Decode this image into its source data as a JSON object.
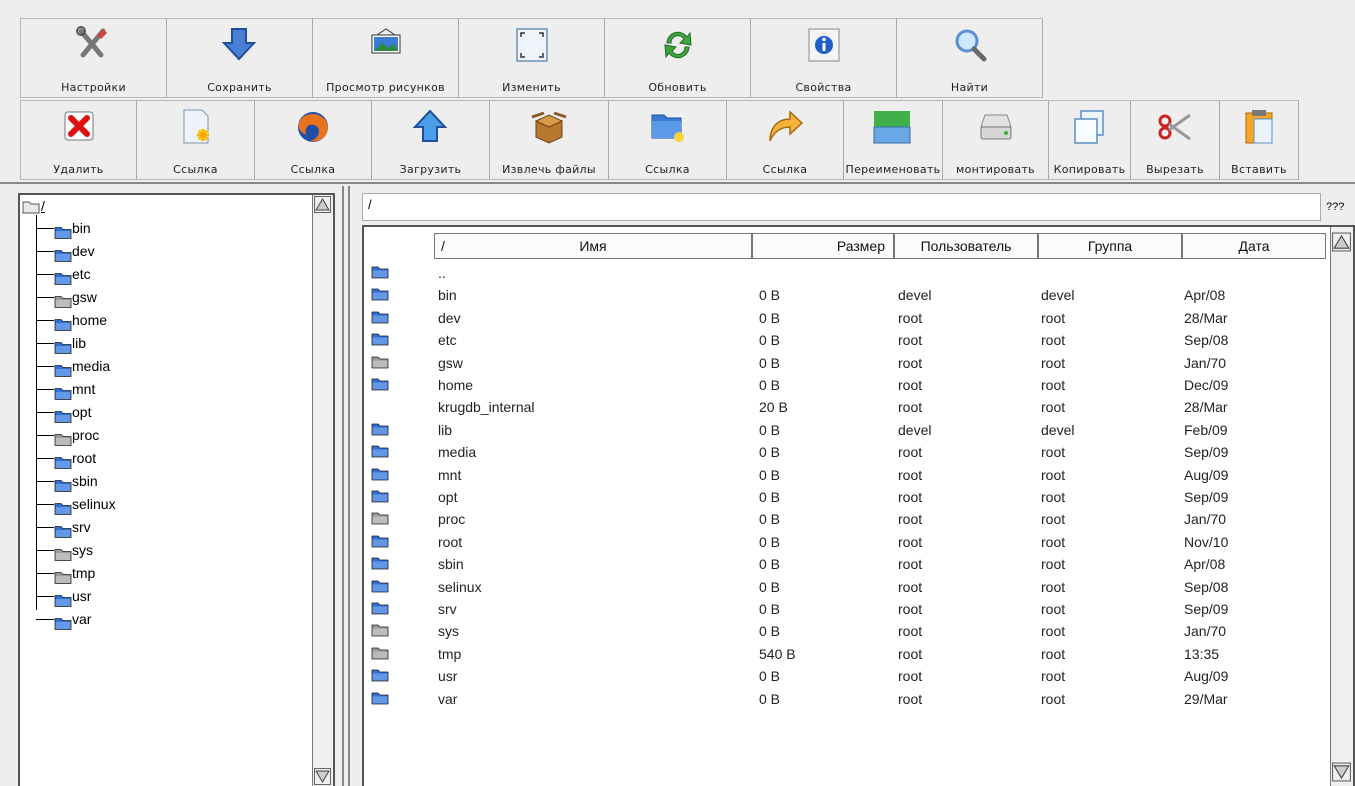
{
  "toolbar_top": [
    {
      "label": "Настройки",
      "icon": "tools-icon",
      "width": 146
    },
    {
      "label": "Сохранить",
      "icon": "save-arrow-icon",
      "width": 146
    },
    {
      "label": "Просмотр рисунков",
      "icon": "image-view-icon",
      "width": 146
    },
    {
      "label": "Изменить",
      "icon": "resize-icon",
      "width": 146
    },
    {
      "label": "Обновить",
      "icon": "refresh-icon",
      "width": 146
    },
    {
      "label": "Свойства",
      "icon": "info-icon",
      "width": 146
    },
    {
      "label": "Найти",
      "icon": "search-icon",
      "width": 146
    }
  ],
  "toolbar_bottom": [
    {
      "label": "Удалить",
      "icon": "delete-icon",
      "width": 116
    },
    {
      "label": "Ссылка",
      "icon": "new-file-icon",
      "width": 118
    },
    {
      "label": "Ссылка",
      "icon": "firefox-icon",
      "width": 117
    },
    {
      "label": "Загрузить",
      "icon": "upload-arrow-icon",
      "width": 118
    },
    {
      "label": "Извлечь файлы",
      "icon": "extract-box-icon",
      "width": 119
    },
    {
      "label": "Ссылка",
      "icon": "new-folder-icon",
      "width": 118
    },
    {
      "label": "Ссылка",
      "icon": "forward-arrow-icon",
      "width": 117
    },
    {
      "label": "Переименовать",
      "icon": "rename-windows-icon",
      "width": 99
    },
    {
      "label": "монтировать",
      "icon": "mount-drive-icon",
      "width": 106
    },
    {
      "label": "Копировать",
      "icon": "copy-icon",
      "width": 82
    },
    {
      "label": "Вырезать",
      "icon": "scissors-icon",
      "width": 89
    },
    {
      "label": "Вставить",
      "icon": "paste-icon",
      "width": 79
    }
  ],
  "tree": {
    "root": "/",
    "items": [
      {
        "name": "bin",
        "color": "blue"
      },
      {
        "name": "dev",
        "color": "blue"
      },
      {
        "name": "etc",
        "color": "blue"
      },
      {
        "name": "gsw",
        "color": "gray"
      },
      {
        "name": "home",
        "color": "blue"
      },
      {
        "name": "lib",
        "color": "blue"
      },
      {
        "name": "media",
        "color": "blue"
      },
      {
        "name": "mnt",
        "color": "blue"
      },
      {
        "name": "opt",
        "color": "blue"
      },
      {
        "name": "proc",
        "color": "gray"
      },
      {
        "name": "root",
        "color": "blue"
      },
      {
        "name": "sbin",
        "color": "blue"
      },
      {
        "name": "selinux",
        "color": "blue"
      },
      {
        "name": "srv",
        "color": "blue"
      },
      {
        "name": "sys",
        "color": "gray"
      },
      {
        "name": "tmp",
        "color": "gray"
      },
      {
        "name": "usr",
        "color": "blue"
      },
      {
        "name": "var",
        "color": "blue"
      }
    ]
  },
  "path": {
    "value": "/",
    "button": "???"
  },
  "list": {
    "columns": {
      "sort": "/",
      "name": "Имя",
      "size": "Размер",
      "user": "Пользователь",
      "group": "Группа",
      "date": "Дата"
    },
    "rows": [
      {
        "name": "..",
        "size": "",
        "user": "",
        "group": "",
        "date": "",
        "icon": "blue"
      },
      {
        "name": "bin",
        "size": "0 B",
        "user": "devel",
        "group": "devel",
        "date": "Apr/08",
        "icon": "blue"
      },
      {
        "name": "dev",
        "size": "0 B",
        "user": "root",
        "group": "root",
        "date": "28/Mar",
        "icon": "blue"
      },
      {
        "name": "etc",
        "size": "0 B",
        "user": "root",
        "group": "root",
        "date": "Sep/08",
        "icon": "blue"
      },
      {
        "name": "gsw",
        "size": "0 B",
        "user": "root",
        "group": "root",
        "date": "Jan/70",
        "icon": "gray"
      },
      {
        "name": "home",
        "size": "0 B",
        "user": "root",
        "group": "root",
        "date": "Dec/09",
        "icon": "blue"
      },
      {
        "name": "krugdb_internal",
        "size": "20 B",
        "user": "root",
        "group": "root",
        "date": "28/Mar",
        "icon": "none"
      },
      {
        "name": "lib",
        "size": "0 B",
        "user": "devel",
        "group": "devel",
        "date": "Feb/09",
        "icon": "blue"
      },
      {
        "name": "media",
        "size": "0 B",
        "user": "root",
        "group": "root",
        "date": "Sep/09",
        "icon": "blue"
      },
      {
        "name": "mnt",
        "size": "0 B",
        "user": "root",
        "group": "root",
        "date": "Aug/09",
        "icon": "blue"
      },
      {
        "name": "opt",
        "size": "0 B",
        "user": "root",
        "group": "root",
        "date": "Sep/09",
        "icon": "blue"
      },
      {
        "name": "proc",
        "size": "0 B",
        "user": "root",
        "group": "root",
        "date": "Jan/70",
        "icon": "gray"
      },
      {
        "name": "root",
        "size": "0 B",
        "user": "root",
        "group": "root",
        "date": "Nov/10",
        "icon": "blue"
      },
      {
        "name": "sbin",
        "size": "0 B",
        "user": "root",
        "group": "root",
        "date": "Apr/08",
        "icon": "blue"
      },
      {
        "name": "selinux",
        "size": "0 B",
        "user": "root",
        "group": "root",
        "date": "Sep/08",
        "icon": "blue"
      },
      {
        "name": "srv",
        "size": "0 B",
        "user": "root",
        "group": "root",
        "date": "Sep/09",
        "icon": "blue"
      },
      {
        "name": "sys",
        "size": "0 B",
        "user": "root",
        "group": "root",
        "date": "Jan/70",
        "icon": "gray"
      },
      {
        "name": "tmp",
        "size": "540 B",
        "user": "root",
        "group": "root",
        "date": "13:35",
        "icon": "gray"
      },
      {
        "name": "usr",
        "size": "0 B",
        "user": "root",
        "group": "root",
        "date": "Aug/09",
        "icon": "blue"
      },
      {
        "name": "var",
        "size": "0 B",
        "user": "root",
        "group": "root",
        "date": "29/Mar",
        "icon": "blue"
      }
    ]
  },
  "colors": {
    "folder_blue": "#2f6fd8",
    "folder_gray": "#9a9a9a",
    "panel_bg": "#eeeeee"
  }
}
